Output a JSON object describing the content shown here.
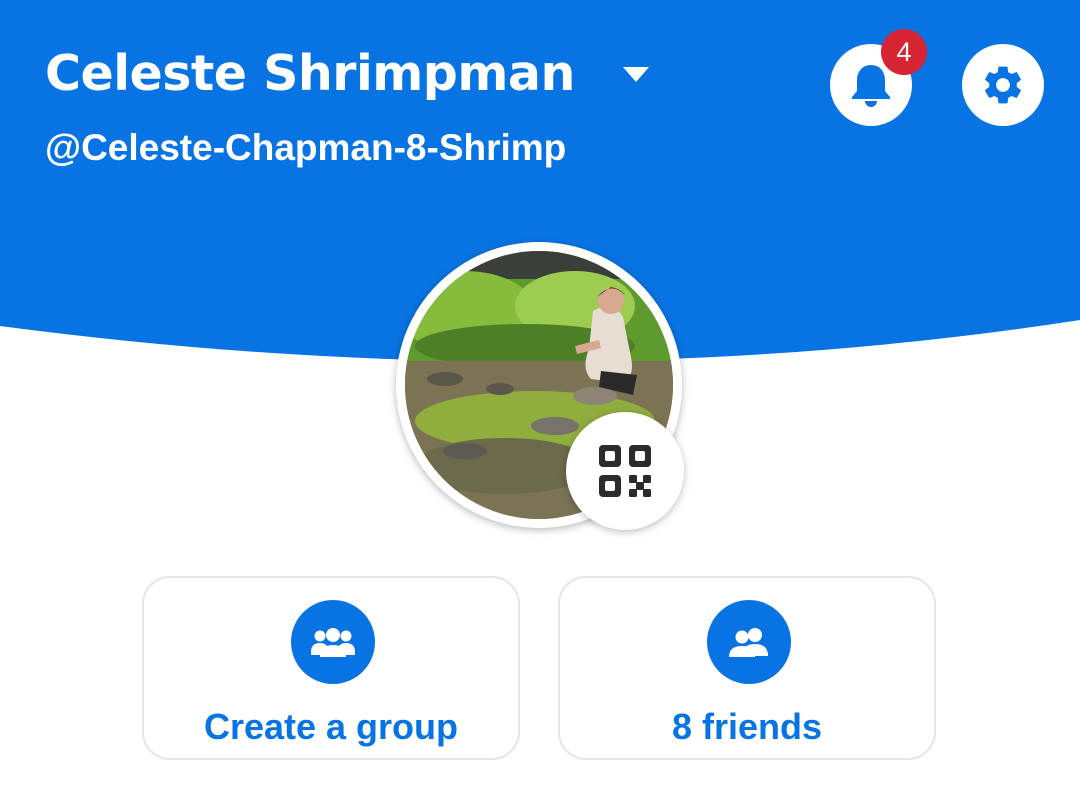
{
  "header": {
    "user_name": "Celeste Shrimpman",
    "user_handle": "@Celeste-Chapman-8-Shrimp",
    "notification_count": "4",
    "background_color": "#0874e3"
  },
  "profile": {
    "avatar_icon": "profile-photo",
    "qr_icon": "qr-code-icon"
  },
  "actions": [
    {
      "label": "Create a group",
      "icon": "group-add-icon"
    },
    {
      "label": "8 friends",
      "icon": "friends-icon"
    }
  ],
  "colors": {
    "accent": "#0874e3",
    "badge": "#d62433"
  }
}
